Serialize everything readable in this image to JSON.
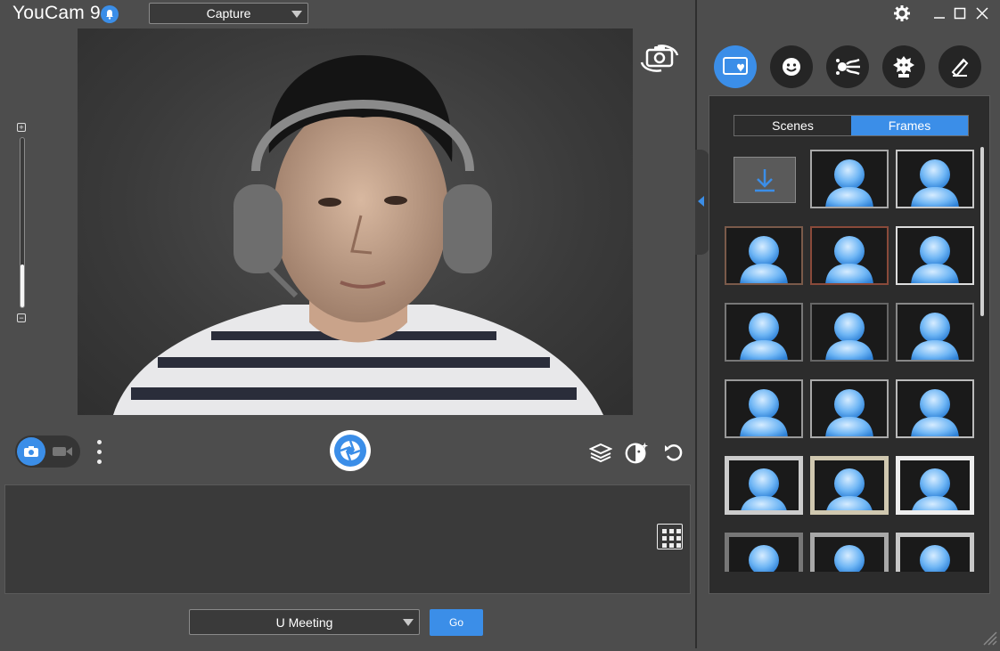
{
  "app": {
    "title": "YouCam 9"
  },
  "topbar": {
    "mode_select_value": "Capture"
  },
  "preview": {
    "zoom_level_fraction": 0.25
  },
  "right_panel": {
    "tools": [
      {
        "name": "frame-tool",
        "active": true
      },
      {
        "name": "face-tool",
        "active": false
      },
      {
        "name": "effects-tool",
        "active": false
      },
      {
        "name": "avatar-tool",
        "active": false
      },
      {
        "name": "brush-tool",
        "active": false
      }
    ],
    "tabs": [
      {
        "label": "Scenes",
        "active": false
      },
      {
        "label": "Frames",
        "active": true
      }
    ]
  },
  "bottom": {
    "meeting_select_value": "U Meeting",
    "go_label": "Go"
  },
  "colors": {
    "accent": "#3b8ee8",
    "background": "#4d4d4d",
    "panel": "#2c2c2c"
  }
}
